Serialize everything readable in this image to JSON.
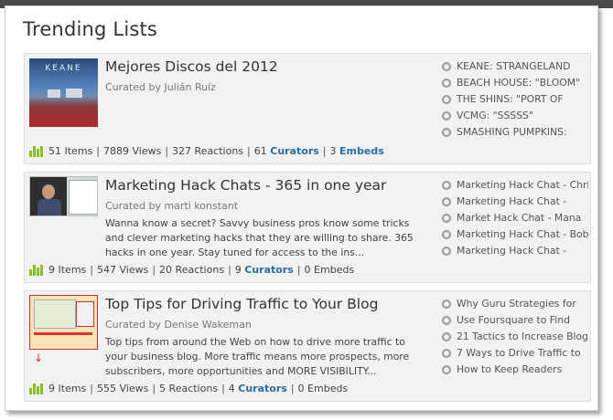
{
  "heading": "Trending Lists",
  "colors": {
    "accent": "#2b6ca3",
    "stats_icon": "#8bbf2a"
  },
  "cards": [
    {
      "title": "Mejores Discos del 2012",
      "curated": "Curated by Julián Ruíz",
      "description": "",
      "thumb_caption": "KEANE",
      "stats": {
        "items": "51 Items",
        "views": "7889 Views",
        "reactions": "327 Reactions",
        "curators_count": "61",
        "curators_label": "Curators",
        "embeds_count": "3",
        "embeds_label": "Embeds"
      },
      "list": [
        "KEANE: STRANGELAND",
        "BEACH HOUSE: \"BLOOM\"",
        "THE SHINS: \"PORT OF",
        "VCMG: \"SSSSS\"",
        "SMASHING PUMPKINS:"
      ]
    },
    {
      "title": "Marketing Hack Chats - 365 in one year",
      "curated": "Curated by marti konstant",
      "description": "Wanna know a secret? Savvy business pros know some tricks and clever marketing hacks that they are willing to share. 365 hacks in one year. Stay tuned for access to the ins...",
      "stats": {
        "items": "9 Items",
        "views": "547 Views",
        "reactions": "20 Reactions",
        "curators_count": "9",
        "curators_label": "Curators",
        "embeds_count": "0",
        "embeds_label": "Embeds"
      },
      "list": [
        "Marketing Hack Chat - Chris",
        "Marketing Hack Chat -",
        "Market Hack Chat - Mana",
        "Marketing Hack Chat - Bob",
        "Marketing Hack Chat -"
      ]
    },
    {
      "title": "Top Tips for Driving Traffic to Your Blog",
      "curated": "Curated by Denise Wakeman",
      "description": "Top tips from around the Web on how to drive more traffic to your business blog. More traffic means more prospects, more subscribers, more opportunities and MORE VISIBILITY...",
      "stats": {
        "items": "9 Items",
        "views": "555 Views",
        "reactions": "5 Reactions",
        "curators_count": "4",
        "curators_label": "Curators",
        "embeds_count": "0",
        "embeds_label": "Embeds"
      },
      "list": [
        "Why Guru Strategies for",
        "Use Foursquare to Find",
        "21 Tactics to Increase Blog",
        "7 Ways to Drive Traffic to",
        "How to Keep Readers"
      ]
    }
  ]
}
